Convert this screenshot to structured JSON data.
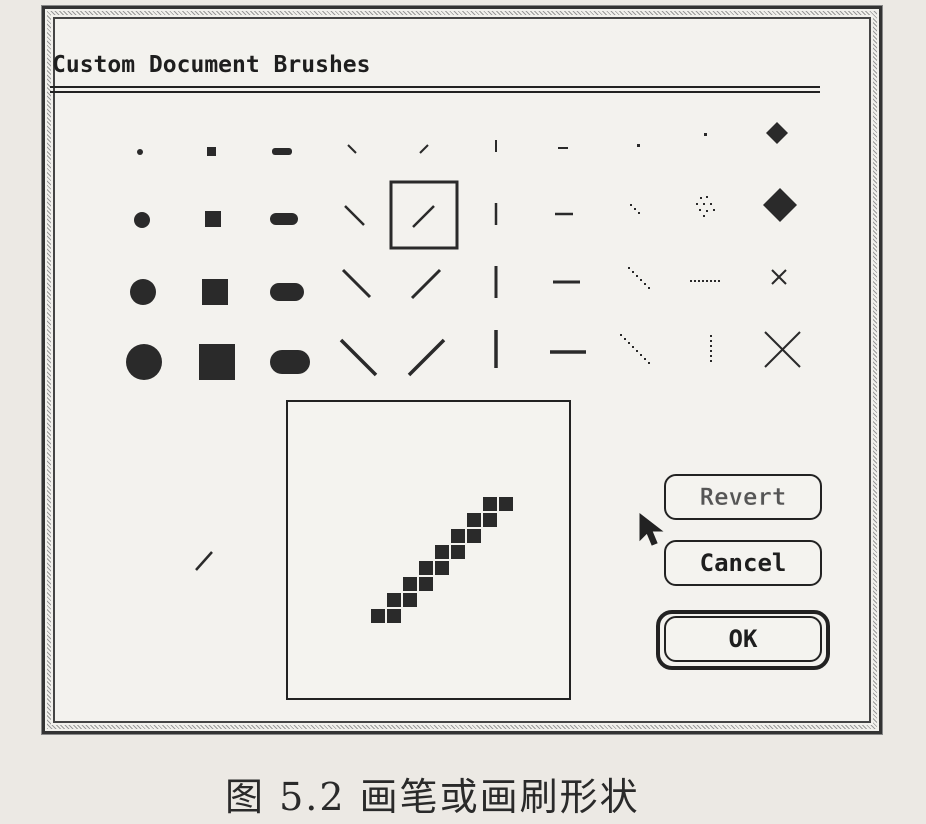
{
  "dialog": {
    "title": "Custom Document Brushes",
    "buttons": {
      "revert": "Revert",
      "cancel": "Cancel",
      "ok": "OK"
    },
    "selected_brush": "diagonal-right-medium"
  },
  "caption": "图 5.2   画笔或画刷形状"
}
